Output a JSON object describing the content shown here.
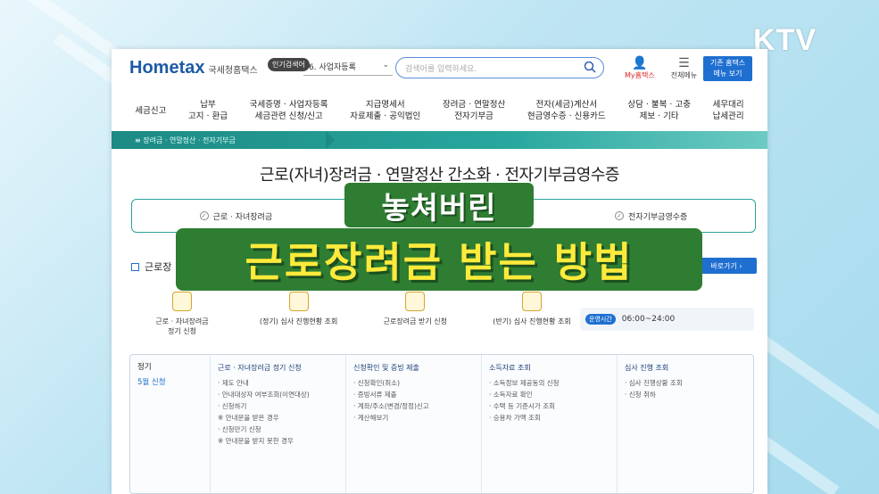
{
  "broadcaster": {
    "logo": "KTV"
  },
  "header": {
    "logo_main": "Hometax",
    "logo_sub": "국세청홈택스",
    "popular_label": "인기검색어",
    "popular_value": "6.  사업자등록",
    "search_placeholder": "검색어를 입력하세요.",
    "my_label": "My홈택스",
    "menu_label": "전체메뉴",
    "quick_label_1": "기존 홈택스",
    "quick_label_2": "메뉴 보기"
  },
  "nav": {
    "items": [
      {
        "line1": "세금신고",
        "line2": ""
      },
      {
        "line1": "납부",
        "line2": "고지 · 환급"
      },
      {
        "line1": "국세증명 · 사업자등록",
        "line2": "세금관련 신청/신고"
      },
      {
        "line1": "지급명세서",
        "line2": "자료제출 · 공익법인"
      },
      {
        "line1": "장려금 · 연말정산",
        "line2": "전자기부금"
      },
      {
        "line1": "전자(세금)계산서",
        "line2": "현금영수증 · 신용카드"
      },
      {
        "line1": "상담 · 불복 · 고충",
        "line2": "제보 · 기타"
      },
      {
        "line1": "세무대리",
        "line2": "납세관리"
      }
    ]
  },
  "breadcrumb": "≡  장려금 · 연말정산 · 전자기부금",
  "page_title": "근로(자녀)장려금 · 연말정산 간소화 · 전자기부금영수증",
  "tabs": [
    {
      "label": "근로 · 자녀장려금"
    },
    {
      "label": "전자기부금영수증"
    }
  ],
  "section": {
    "title": "근로장",
    "quick_button": "바로가기"
  },
  "services": [
    {
      "line1": "근로 · 자녀장려금",
      "line2": "정기 신청"
    },
    {
      "line1": "(정기) 심사 진행현황 조회",
      "line2": ""
    },
    {
      "line1": "근로장려금 받기 신청",
      "line2": ""
    },
    {
      "line1": "(반기) 심사 진행현황 조회",
      "line2": ""
    }
  ],
  "hours": {
    "tag": "운영시간",
    "value": "06:00~24:00"
  },
  "grid": {
    "period": {
      "title": "정기",
      "value": "5월 신청"
    },
    "columns": [
      {
        "head": "근로 · 자녀장려금 정기 신청",
        "items": [
          "· 제도 안내",
          "· 안내대상자 여부조회(이연대상)",
          "· 신청하기",
          "※ 안내문을 받은 경우",
          "· 신청만기 신청",
          "※ 안내문을 받지 못한 경우"
        ]
      },
      {
        "head": "신청확인 및 증빙 제출",
        "items": [
          "· 신청확인(취소)",
          "· 증빙서류 제출",
          "· 계좌/주소(변경/정정)신고",
          "· 계산해보기"
        ]
      },
      {
        "head": "소득자료 조회",
        "items": [
          "· 소득정보 제공동의 신청",
          "· 소득자료 확인",
          "· 수택 등 기준시가 조회",
          "· 승용차 가액 조회"
        ]
      },
      {
        "head": "심사 진행 조회",
        "items": [
          "· 심사 진행상황 조회",
          "· 신청 취하"
        ]
      }
    ]
  },
  "captions": {
    "line1": "놓쳐버린",
    "line2": "근로장려금 받는 방법"
  }
}
